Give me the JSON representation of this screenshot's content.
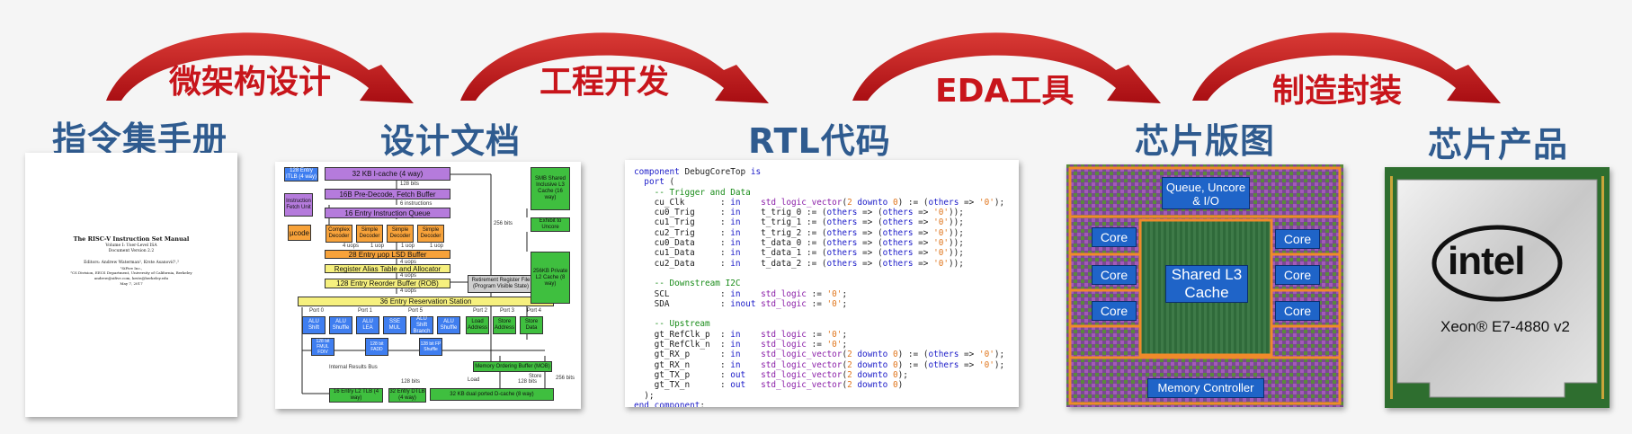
{
  "stages": [
    {
      "id": "isa",
      "title": "指令集手册"
    },
    {
      "id": "design",
      "title": "设计文档"
    },
    {
      "id": "rtl",
      "title": "RTL代码"
    },
    {
      "id": "layout",
      "title": "芯片版图"
    },
    {
      "id": "product",
      "title": "芯片产品"
    }
  ],
  "arrows": [
    {
      "label": "微架构设计"
    },
    {
      "label": "工程开发"
    },
    {
      "label": "EDA工具"
    },
    {
      "label": "制造封装"
    }
  ],
  "manual": {
    "title": "The RISC-V Instruction Set Manual",
    "volume": "Volume I: User-Level ISA",
    "version": "Document Version 2.2",
    "editors": "Editors: Andrew Waterman¹, Krste Asanović¹,²",
    "aff1": "¹SiFive Inc.,",
    "aff2": "²CS Division, EECS Department, University of California, Berkeley",
    "emails": "andrew@sifive.com, krste@berkeley.edu",
    "date": "May 7, 2017"
  },
  "block_diagram": {
    "icache": "32 KB I-cache (4 way)",
    "bits128": "128 bits",
    "predecode": "16B Pre-Decode, Fetch Buffer",
    "instructions": "6 instructions",
    "iq": "16 Entry Instruction Queue",
    "itlb": "128 Entry ITLB (4 way)",
    "ifu": "Instruction Fetch Unit",
    "ucode": "µcode",
    "complex": "Complex Decoder",
    "simple1": "Simple Decoder",
    "simple2": "Simple Decoder",
    "simple3": "Simple Decoder",
    "uops4a": "4 uops",
    "uops1": "1 uop",
    "uops1b": "1 uop",
    "uops1c": "1 uop",
    "lsd": "28 Entry µop LSD Buffer",
    "uops4b": "4 uops",
    "rat": "Register Alias Table and Allocator",
    "uops4c": "4 uops",
    "rob": "128 Entry Reorder Buffer (ROB)",
    "uops4d": "4 uops",
    "retire": "Retirement Register File (Program Visible State)",
    "rs": "36 Entry Reservation Station",
    "ports": [
      "Port 0",
      "Port 1",
      "Port 5",
      "Port 2",
      "Port 3",
      "Port 4"
    ],
    "units": [
      "ALU Shift",
      "ALU Shuffle",
      "ALU LEA",
      "SSE MUL",
      "ALU Shift Branch",
      "ALU Shuffle",
      "Load Address",
      "Store Address",
      "Store Data"
    ],
    "fmul": "128 bit FMUL FDIV",
    "fadd": "128 bit FADD",
    "fpshuffle": "128 bit FP Shuffle",
    "results": "Internal Results Bus",
    "load": "Load",
    "store": "Store",
    "mob": "Memory Ordering Buffer (MOB)",
    "b128a": "128 bits",
    "b128b": "128 bits",
    "b256a": "256 bits",
    "b256b": "256 bits",
    "l2tlb": "16 Entry L2 TLB (4 way)",
    "dtlb": "32 Entry DTLB (4 way)",
    "dcache": "32 KB dual ported D-cache (8 way)",
    "smb": "SMB Shared Inclusive L3 Cache (16 way)",
    "uncore": "Exhibit to Uncore",
    "l2": "256KB Private L2 Cache (8 way)"
  },
  "code_lines": [
    [
      {
        "t": "component",
        "c": "kw"
      },
      {
        "t": " DebugCoreTop ",
        "c": ""
      },
      {
        "t": "is",
        "c": "kw"
      }
    ],
    [
      {
        "t": "  ",
        "c": ""
      },
      {
        "t": "port",
        "c": "kw"
      },
      {
        "t": " (",
        "c": ""
      }
    ],
    [
      {
        "t": "    -- Trigger and Data",
        "c": "cm"
      }
    ],
    [
      {
        "t": "    cu_Clk       : ",
        "c": ""
      },
      {
        "t": "in",
        "c": "kw"
      },
      {
        "t": "    ",
        "c": ""
      },
      {
        "t": "std_logic_vector",
        "c": "ty"
      },
      {
        "t": "(",
        "c": ""
      },
      {
        "t": "2",
        "c": "nm"
      },
      {
        "t": " ",
        "c": ""
      },
      {
        "t": "downto",
        "c": "kw"
      },
      {
        "t": " ",
        "c": ""
      },
      {
        "t": "0",
        "c": "nm"
      },
      {
        "t": ") := (",
        "c": ""
      },
      {
        "t": "others",
        "c": "kw"
      },
      {
        "t": " => ",
        "c": ""
      },
      {
        "t": "'0'",
        "c": "nm"
      },
      {
        "t": ");",
        "c": ""
      }
    ],
    [
      {
        "t": "    cu0_Trig     : ",
        "c": ""
      },
      {
        "t": "in",
        "c": "kw"
      },
      {
        "t": "    t_trig_0 := (",
        "c": ""
      },
      {
        "t": "others",
        "c": "kw"
      },
      {
        "t": " => (",
        "c": ""
      },
      {
        "t": "others",
        "c": "kw"
      },
      {
        "t": " => ",
        "c": ""
      },
      {
        "t": "'0'",
        "c": "nm"
      },
      {
        "t": "));",
        "c": ""
      }
    ],
    [
      {
        "t": "    cu1_Trig     : ",
        "c": ""
      },
      {
        "t": "in",
        "c": "kw"
      },
      {
        "t": "    t_trig_1 := (",
        "c": ""
      },
      {
        "t": "others",
        "c": "kw"
      },
      {
        "t": " => (",
        "c": ""
      },
      {
        "t": "others",
        "c": "kw"
      },
      {
        "t": " => ",
        "c": ""
      },
      {
        "t": "'0'",
        "c": "nm"
      },
      {
        "t": "));",
        "c": ""
      }
    ],
    [
      {
        "t": "    cu2_Trig     : ",
        "c": ""
      },
      {
        "t": "in",
        "c": "kw"
      },
      {
        "t": "    t_trig_2 := (",
        "c": ""
      },
      {
        "t": "others",
        "c": "kw"
      },
      {
        "t": " => (",
        "c": ""
      },
      {
        "t": "others",
        "c": "kw"
      },
      {
        "t": " => ",
        "c": ""
      },
      {
        "t": "'0'",
        "c": "nm"
      },
      {
        "t": "));",
        "c": ""
      }
    ],
    [
      {
        "t": "    cu0_Data     : ",
        "c": ""
      },
      {
        "t": "in",
        "c": "kw"
      },
      {
        "t": "    t_data_0 := (",
        "c": ""
      },
      {
        "t": "others",
        "c": "kw"
      },
      {
        "t": " => (",
        "c": ""
      },
      {
        "t": "others",
        "c": "kw"
      },
      {
        "t": " => ",
        "c": ""
      },
      {
        "t": "'0'",
        "c": "nm"
      },
      {
        "t": "));",
        "c": ""
      }
    ],
    [
      {
        "t": "    cu1_Data     : ",
        "c": ""
      },
      {
        "t": "in",
        "c": "kw"
      },
      {
        "t": "    t_data_1 := (",
        "c": ""
      },
      {
        "t": "others",
        "c": "kw"
      },
      {
        "t": " => (",
        "c": ""
      },
      {
        "t": "others",
        "c": "kw"
      },
      {
        "t": " => ",
        "c": ""
      },
      {
        "t": "'0'",
        "c": "nm"
      },
      {
        "t": "));",
        "c": ""
      }
    ],
    [
      {
        "t": "    cu2_Data     : ",
        "c": ""
      },
      {
        "t": "in",
        "c": "kw"
      },
      {
        "t": "    t_data_2 := (",
        "c": ""
      },
      {
        "t": "others",
        "c": "kw"
      },
      {
        "t": " => (",
        "c": ""
      },
      {
        "t": "others",
        "c": "kw"
      },
      {
        "t": " => ",
        "c": ""
      },
      {
        "t": "'0'",
        "c": "nm"
      },
      {
        "t": "));",
        "c": ""
      }
    ],
    [
      {
        "t": "",
        "c": ""
      }
    ],
    [
      {
        "t": "    -- Downstream I2C",
        "c": "cm"
      }
    ],
    [
      {
        "t": "    SCL          : ",
        "c": ""
      },
      {
        "t": "in",
        "c": "kw"
      },
      {
        "t": "    ",
        "c": ""
      },
      {
        "t": "std_logic",
        "c": "ty"
      },
      {
        "t": " := ",
        "c": ""
      },
      {
        "t": "'0'",
        "c": "nm"
      },
      {
        "t": ";",
        "c": ""
      }
    ],
    [
      {
        "t": "    SDA          : ",
        "c": ""
      },
      {
        "t": "inout",
        "c": "kw"
      },
      {
        "t": " ",
        "c": ""
      },
      {
        "t": "std_logic",
        "c": "ty"
      },
      {
        "t": " := ",
        "c": ""
      },
      {
        "t": "'0'",
        "c": "nm"
      },
      {
        "t": ";",
        "c": ""
      }
    ],
    [
      {
        "t": "",
        "c": ""
      }
    ],
    [
      {
        "t": "    -- Upstream",
        "c": "cm"
      }
    ],
    [
      {
        "t": "    gt_RefClk_p  : ",
        "c": ""
      },
      {
        "t": "in",
        "c": "kw"
      },
      {
        "t": "    ",
        "c": ""
      },
      {
        "t": "std_logic",
        "c": "ty"
      },
      {
        "t": " := ",
        "c": ""
      },
      {
        "t": "'0'",
        "c": "nm"
      },
      {
        "t": ";",
        "c": ""
      }
    ],
    [
      {
        "t": "    gt_RefClk_n  : ",
        "c": ""
      },
      {
        "t": "in",
        "c": "kw"
      },
      {
        "t": "    ",
        "c": ""
      },
      {
        "t": "std_logic",
        "c": "ty"
      },
      {
        "t": " := ",
        "c": ""
      },
      {
        "t": "'0'",
        "c": "nm"
      },
      {
        "t": ";",
        "c": ""
      }
    ],
    [
      {
        "t": "    gt_RX_p      : ",
        "c": ""
      },
      {
        "t": "in",
        "c": "kw"
      },
      {
        "t": "    ",
        "c": ""
      },
      {
        "t": "std_logic_vector",
        "c": "ty"
      },
      {
        "t": "(",
        "c": ""
      },
      {
        "t": "2",
        "c": "nm"
      },
      {
        "t": " ",
        "c": ""
      },
      {
        "t": "downto",
        "c": "kw"
      },
      {
        "t": " ",
        "c": ""
      },
      {
        "t": "0",
        "c": "nm"
      },
      {
        "t": ") := (",
        "c": ""
      },
      {
        "t": "others",
        "c": "kw"
      },
      {
        "t": " => ",
        "c": ""
      },
      {
        "t": "'0'",
        "c": "nm"
      },
      {
        "t": ");",
        "c": ""
      }
    ],
    [
      {
        "t": "    gt_RX_n      : ",
        "c": ""
      },
      {
        "t": "in",
        "c": "kw"
      },
      {
        "t": "    ",
        "c": ""
      },
      {
        "t": "std_logic_vector",
        "c": "ty"
      },
      {
        "t": "(",
        "c": ""
      },
      {
        "t": "2",
        "c": "nm"
      },
      {
        "t": " ",
        "c": ""
      },
      {
        "t": "downto",
        "c": "kw"
      },
      {
        "t": " ",
        "c": ""
      },
      {
        "t": "0",
        "c": "nm"
      },
      {
        "t": ") := (",
        "c": ""
      },
      {
        "t": "others",
        "c": "kw"
      },
      {
        "t": " => ",
        "c": ""
      },
      {
        "t": "'0'",
        "c": "nm"
      },
      {
        "t": ");",
        "c": ""
      }
    ],
    [
      {
        "t": "    gt_TX_p      : ",
        "c": ""
      },
      {
        "t": "out",
        "c": "kw"
      },
      {
        "t": "   ",
        "c": ""
      },
      {
        "t": "std_logic_vector",
        "c": "ty"
      },
      {
        "t": "(",
        "c": ""
      },
      {
        "t": "2",
        "c": "nm"
      },
      {
        "t": " ",
        "c": ""
      },
      {
        "t": "downto",
        "c": "kw"
      },
      {
        "t": " ",
        "c": ""
      },
      {
        "t": "0",
        "c": "nm"
      },
      {
        "t": ");",
        "c": ""
      }
    ],
    [
      {
        "t": "    gt_TX_n      : ",
        "c": ""
      },
      {
        "t": "out",
        "c": "kw"
      },
      {
        "t": "   ",
        "c": ""
      },
      {
        "t": "std_logic_vector",
        "c": "ty"
      },
      {
        "t": "(",
        "c": ""
      },
      {
        "t": "2",
        "c": "nm"
      },
      {
        "t": " ",
        "c": ""
      },
      {
        "t": "downto",
        "c": "kw"
      },
      {
        "t": " ",
        "c": ""
      },
      {
        "t": "0",
        "c": "nm"
      },
      {
        "t": ")",
        "c": ""
      }
    ],
    [
      {
        "t": "  );",
        "c": ""
      }
    ],
    [
      {
        "t": "end",
        "c": "kw"
      },
      {
        "t": " ",
        "c": ""
      },
      {
        "t": "component",
        "c": "kw"
      },
      {
        "t": ";",
        "c": ""
      }
    ]
  ],
  "die": {
    "queue": "Queue, Uncore & I/O",
    "core": "Core",
    "l3": "Shared L3 Cache",
    "memctl": "Memory Controller"
  },
  "cpu": {
    "brand": "intel",
    "model": "Xeon® E7-4880 v2"
  },
  "colors": {
    "title_blue": "#2f5b8f",
    "arc_red": "#c8151b"
  }
}
